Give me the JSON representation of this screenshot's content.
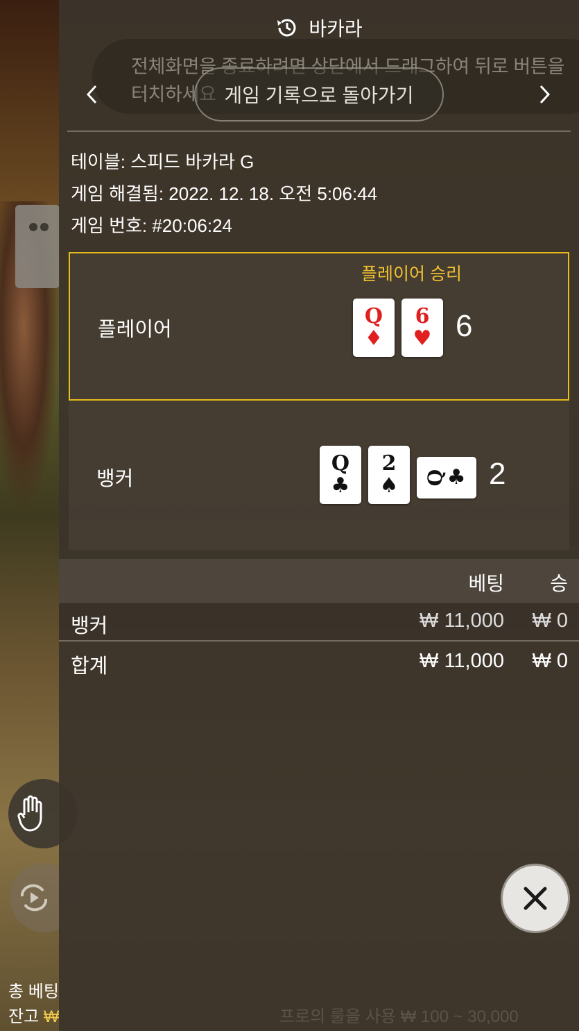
{
  "background": {
    "total_bet_label": "총 베팅",
    "balance_label": "잔고",
    "balance_currency": "₩",
    "footer_ghost": "프로의 룰을 사용 ₩ 100 ~ 30,000"
  },
  "panel": {
    "title": "바카라",
    "title_icon": "history-icon",
    "fullscreen_hint": "전체화면을 종료하려면 상단에서 드래그하여 뒤로 버튼을 터치하세요",
    "back_to_history": "게임 기록으로 돌아가기",
    "info": {
      "table": "테이블: 스피드 바카라 G",
      "resolved": "게임 해결됨: 2022. 12. 18. 오전 5:06:44",
      "number": "게임 번호: #20:06:24"
    },
    "player": {
      "winner_label": "플레이어 승리",
      "label": "플레이어",
      "cards": [
        {
          "rank": "Q",
          "suit": "♦",
          "color": "red"
        },
        {
          "rank": "6",
          "suit": "♥",
          "color": "red"
        }
      ],
      "score": "6"
    },
    "banker": {
      "label": "뱅커",
      "cards": [
        {
          "rank": "Q",
          "suit": "♣",
          "color": "black"
        },
        {
          "rank": "2",
          "suit": "♠",
          "color": "black"
        },
        {
          "rank": "Q",
          "suit": "♣",
          "color": "black",
          "rotated": true
        }
      ],
      "score": "2"
    },
    "bets": {
      "header_bet": "베팅",
      "header_win": "승",
      "rows": [
        {
          "name": "뱅커",
          "bet": "₩ 11,000",
          "win": "₩ 0"
        },
        {
          "name": "합계",
          "bet": "₩ 11,000",
          "win": "₩ 0"
        }
      ]
    },
    "close_icon": "close-icon"
  },
  "colors": {
    "winner_border": "#e9bd1c",
    "winner_text": "#f2c230",
    "red_suit": "#e02020"
  }
}
